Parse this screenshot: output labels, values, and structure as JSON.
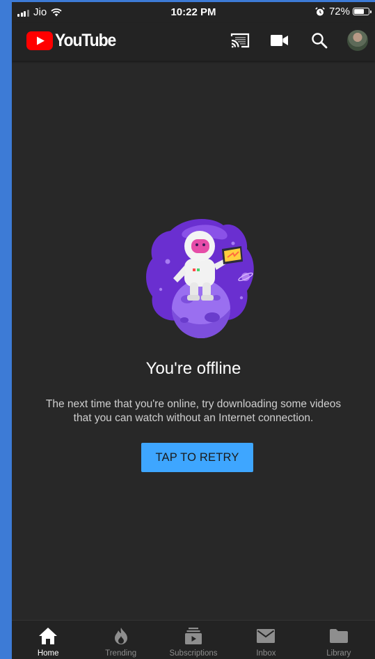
{
  "status_bar": {
    "carrier": "Jio",
    "time": "10:22 PM",
    "battery_percent": "72%",
    "battery_level": 0.72
  },
  "app_bar": {
    "logo_text": "YouTube",
    "actions": [
      {
        "name": "cast",
        "icon": "cast-icon"
      },
      {
        "name": "upload",
        "icon": "video-camera-icon"
      },
      {
        "name": "search",
        "icon": "search-icon"
      },
      {
        "name": "account",
        "icon": "avatar"
      }
    ]
  },
  "offline": {
    "title": "You're offline",
    "message": "The next time that you're online, try downloading some videos that you can watch without an Internet connection.",
    "retry_label": "TAP TO RETRY"
  },
  "bottom_nav": {
    "items": [
      {
        "label": "Home",
        "icon": "home-icon",
        "active": true
      },
      {
        "label": "Trending",
        "icon": "flame-icon",
        "active": false
      },
      {
        "label": "Subscriptions",
        "icon": "subscriptions-icon",
        "active": false
      },
      {
        "label": "Inbox",
        "icon": "mail-icon",
        "active": false
      },
      {
        "label": "Library",
        "icon": "folder-icon",
        "active": false
      }
    ]
  },
  "colors": {
    "background": "#282828",
    "bar": "#232323",
    "accent_blue": "#3ea6ff",
    "youtube_red": "#ff0000",
    "illustration_purple": "#6a2fd0"
  }
}
